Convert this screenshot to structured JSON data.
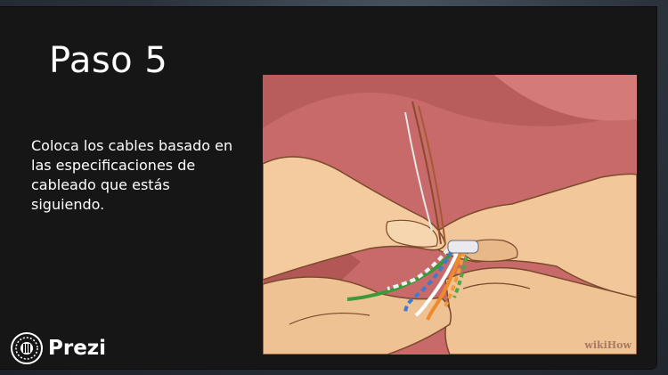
{
  "slide": {
    "title": "Paso 5",
    "body": "Coloca los cables basado en las especificaciones de cableado que estás siguiendo."
  },
  "illustration": {
    "watermark": "wikiHow"
  },
  "branding": {
    "logo_text": "Prezi",
    "logo_icon": "prezi-logo-icon"
  },
  "colors": {
    "slide_background": "#161616",
    "text": "#ffffff",
    "photo_background": "#c96b6b"
  }
}
